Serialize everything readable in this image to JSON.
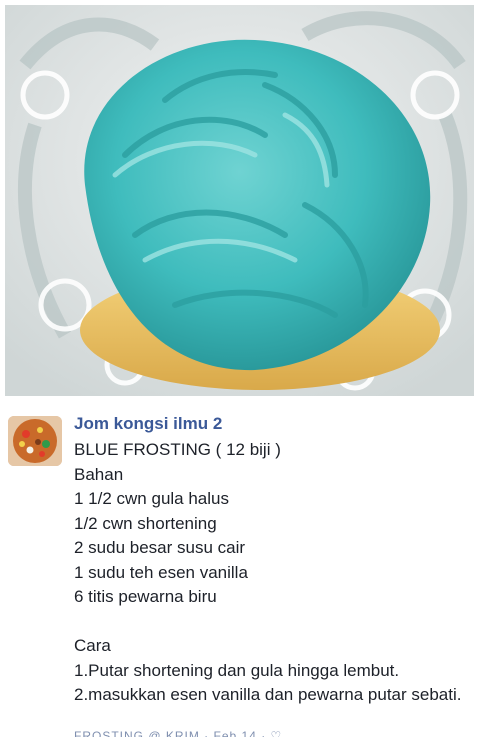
{
  "post": {
    "author": "Jom kongsi ilmu 2",
    "lines": [
      "BLUE FROSTING ( 12 biji )",
      "Bahan",
      "1 1/2 cwn gula halus",
      "1/2 cwn shortening",
      "2 sudu besar susu cair",
      "1 sudu teh esen vanilla",
      "6 titis pewarna biru",
      "",
      "Cara",
      "1.Putar shortening dan gula hingga lembut.",
      "2.masukkan esen vanilla dan pewarna putar sebati."
    ],
    "footer_partial": "FROSTING @ KRIM · Feb 14 · ♡"
  },
  "colors": {
    "frosting": "#3fbcbd",
    "author": "#3b5998",
    "text": "#1d2129"
  }
}
